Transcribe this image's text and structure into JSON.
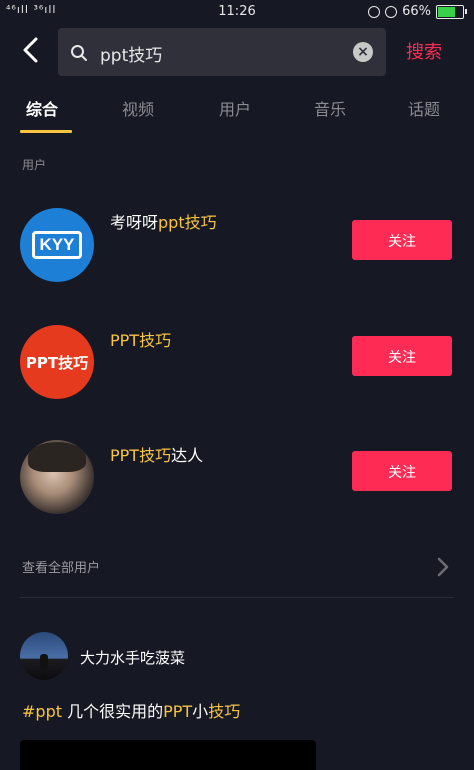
{
  "status": {
    "signal": "⁴⁶ıll ³⁶ıll",
    "time": "11:26",
    "battery": "66%"
  },
  "search": {
    "query": "ppt技巧",
    "button_label": "搜索"
  },
  "tabs": [
    {
      "label": "综合",
      "active": true
    },
    {
      "label": "视频",
      "active": false
    },
    {
      "label": "用户",
      "active": false
    },
    {
      "label": "音乐",
      "active": false
    },
    {
      "label": "话题",
      "active": false
    }
  ],
  "section_label": "用户",
  "users": [
    {
      "name_prefix": "考呀呀",
      "name_highlight": "ppt技巧",
      "name_suffix": "",
      "follow_label": "关注",
      "avatar_text": "KYY"
    },
    {
      "name_prefix": "",
      "name_highlight": "PPT技巧",
      "name_suffix": "",
      "follow_label": "关注",
      "avatar_text": "PPT技巧"
    },
    {
      "name_prefix": "",
      "name_highlight": "PPT技巧",
      "name_suffix": "达人",
      "follow_label": "关注",
      "avatar_text": ""
    }
  ],
  "view_all_users": "查看全部用户",
  "video": {
    "author": "大力水手吃菠菜",
    "title_highlight1": "#ppt",
    "title_mid": " 几个很实用的",
    "title_highlight2": "PPT",
    "title_mid2": "小",
    "title_highlight3": "技巧"
  },
  "colors": {
    "accent": "#fe2c55",
    "highlight": "#f9c440",
    "background": "#161823"
  }
}
